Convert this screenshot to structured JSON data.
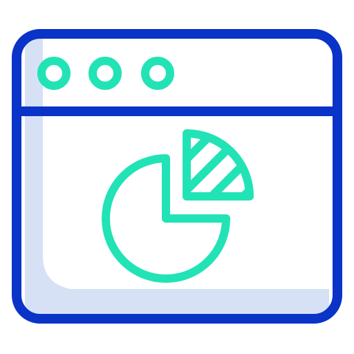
{
  "icon": {
    "name": "browser-window-pie-chart-icon",
    "parts": {
      "window": "browser-window-icon",
      "window_controls": [
        "window-dot-icon",
        "window-dot-icon",
        "window-dot-icon"
      ],
      "chart": "pie-chart-icon"
    },
    "colors": {
      "outline": "#0A33C7",
      "accent": "#22E3B6",
      "fill_shadow": "#D6E1F5",
      "background": "#FFFFFF"
    }
  }
}
